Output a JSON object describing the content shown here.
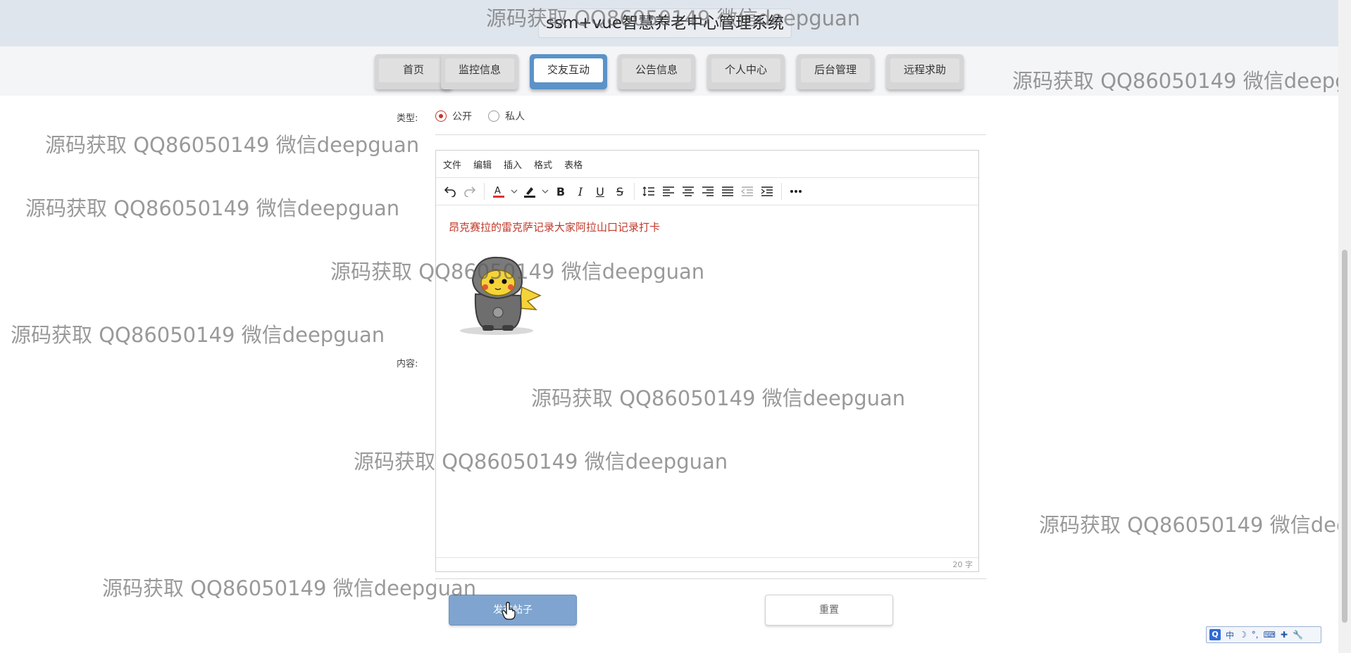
{
  "header": {
    "title": "ssm+vue智慧养老中心管理系统"
  },
  "nav": {
    "items": [
      {
        "label": "首页"
      },
      {
        "label": "监控信息"
      },
      {
        "label": "交友互动"
      },
      {
        "label": "公告信息"
      },
      {
        "label": "个人中心"
      },
      {
        "label": "后台管理"
      },
      {
        "label": "远程求助"
      }
    ],
    "active": "交友互动"
  },
  "form": {
    "type_label": "类型:",
    "type_options": [
      {
        "label": "公开",
        "checked": true
      },
      {
        "label": "私人",
        "checked": false
      }
    ],
    "content_label": "内容:"
  },
  "editor": {
    "menu": [
      "文件",
      "编辑",
      "插入",
      "格式",
      "表格"
    ],
    "content_text": "昂克赛拉的雷克萨记录大家阿拉山口记录打卡",
    "word_count": "20 字",
    "text_color": "#c0392b"
  },
  "buttons": {
    "submit": "发布帖子",
    "reset": "重置"
  },
  "watermark": {
    "text": "源码获取 QQ86050149 微信deepguan"
  },
  "ime": {
    "items": [
      "中",
      "☽",
      "°,",
      "⌨",
      "✚",
      "🔧"
    ]
  },
  "colors": {
    "active_nav": "#5b92c8",
    "submit_bg": "#7fa4cf",
    "header_bg": "#dfe5ec"
  }
}
